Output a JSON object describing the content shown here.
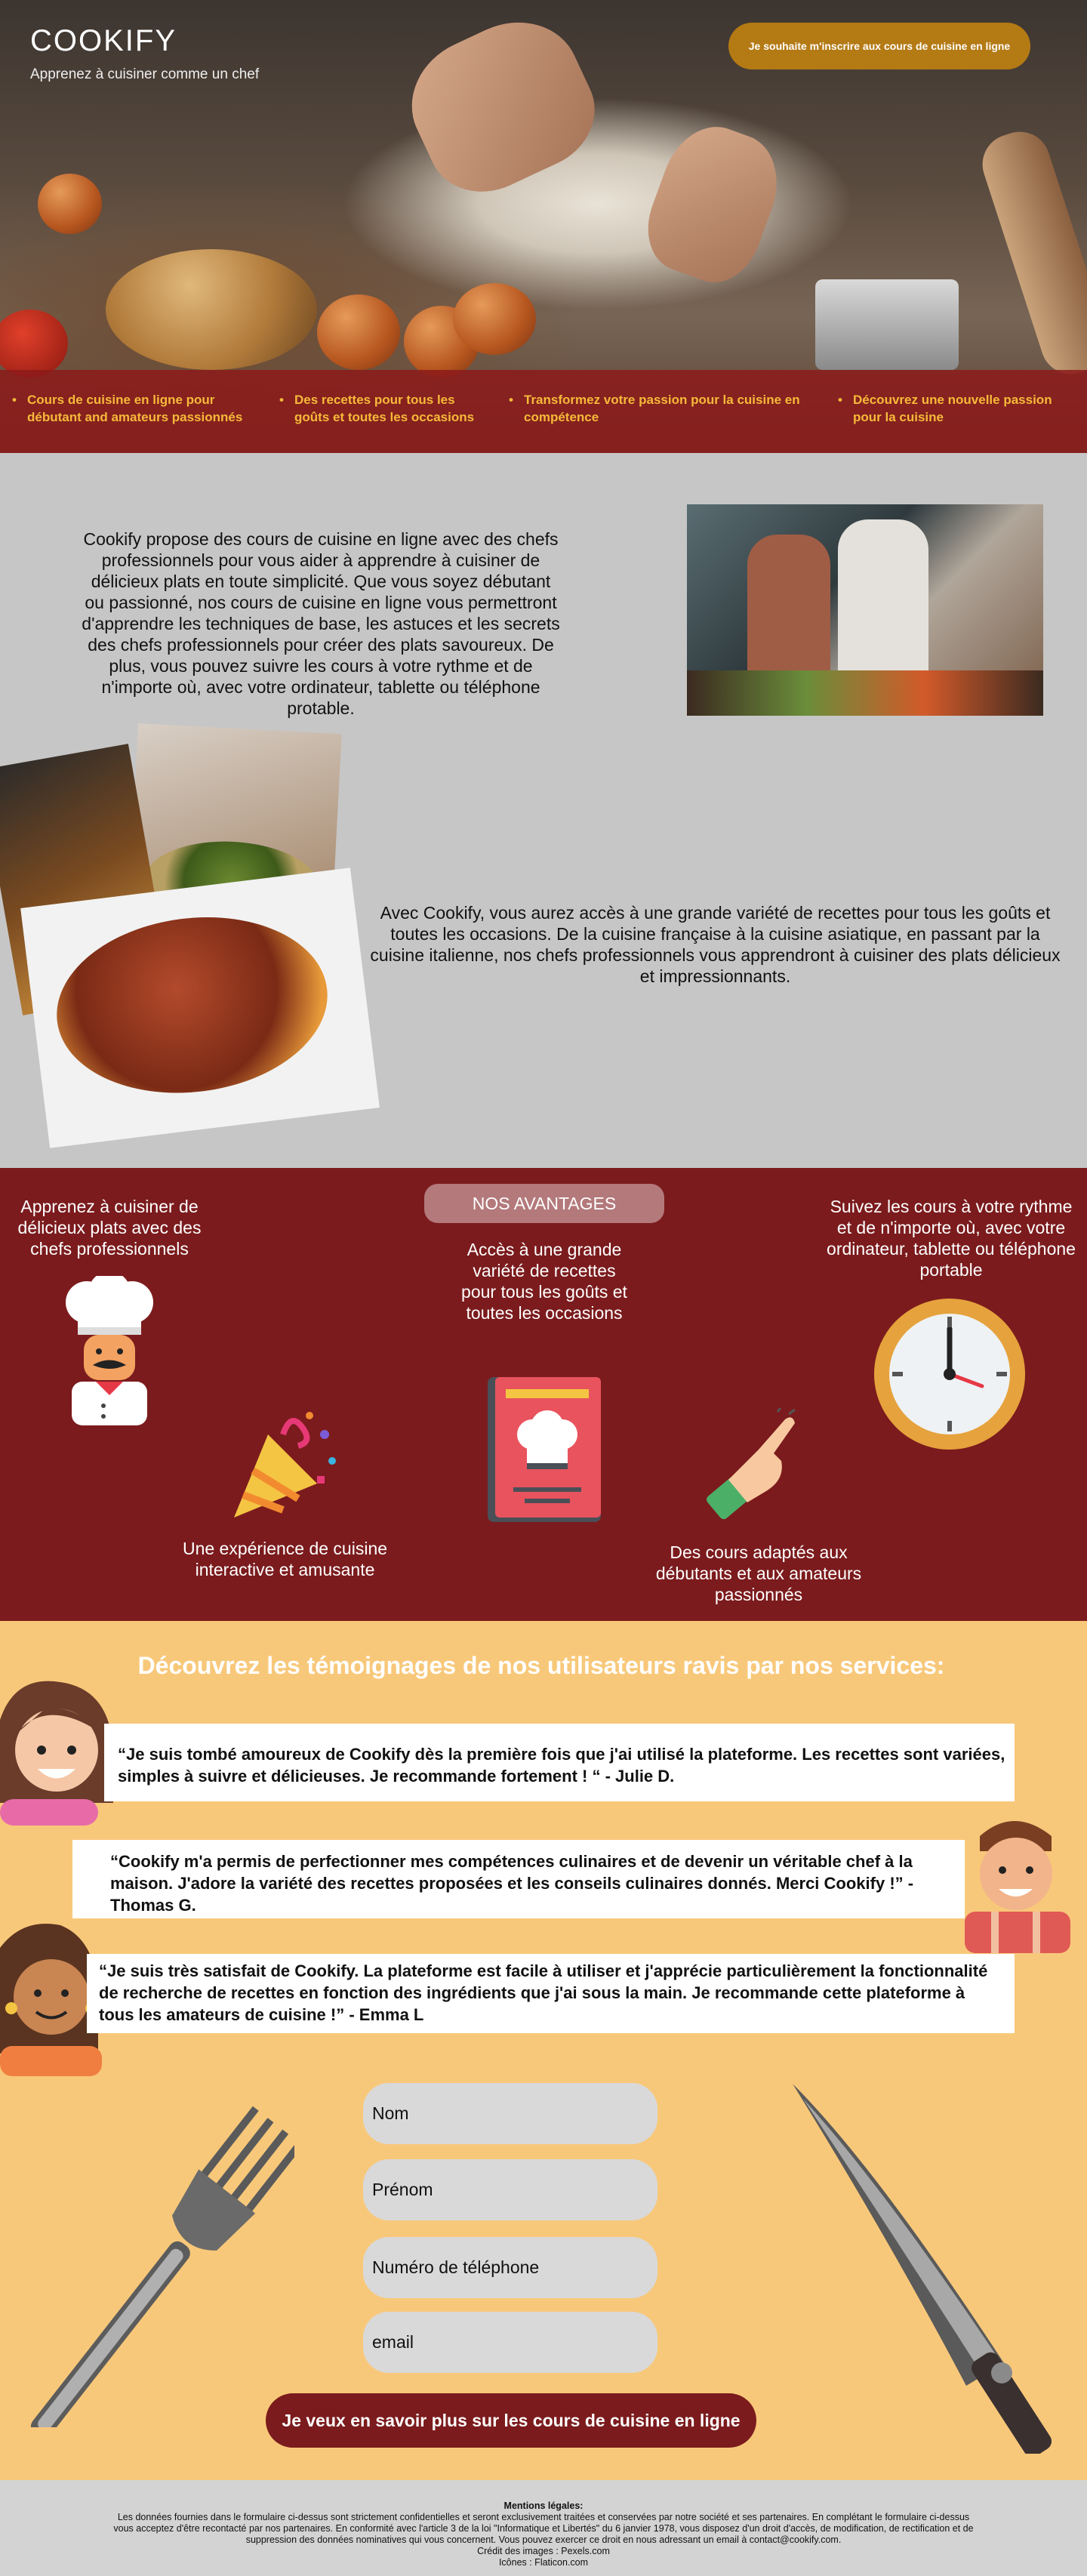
{
  "header": {
    "brand": "COOKIFY",
    "tagline": "Apprenez à cuisiner comme un chef",
    "cta": "Je souhaite m'inscrire aux cours de cuisine en ligne"
  },
  "features": [
    "Cours de cuisine en ligne pour débutant and amateurs passionnés",
    "Des recettes pour tous les goûts et toutes les occasions",
    "Transformez votre passion pour la cuisine en compétence",
    "Découvrez une nouvelle passion pour la cuisine"
  ],
  "intro": {
    "p1": "Cookify propose des cours de cuisine en ligne avec des chefs professionnels pour vous aider à apprendre à cuisiner de délicieux plats en toute simplicité. Que vous soyez débutant ou passionné, nos cours de cuisine en ligne vous permettront d'apprendre les techniques de base, les astuces et les secrets des chefs professionnels pour créer des plats savoureux. De plus, vous pouvez suivre les cours à votre rythme et de n'importe où, avec votre ordinateur, tablette ou téléphone protable.",
    "p2": "Avec Cookify, vous aurez accès à une grande variété de recettes pour tous les goûts et toutes les occasions. De la cuisine française à la cuisine asiatique, en passant par la cuisine italienne, nos chefs professionnels vous apprendront à cuisiner des plats délicieux et impressionnants."
  },
  "advantages": {
    "title": "NOS AVANTAGES",
    "a1": "Apprenez à cuisiner de délicieux plats avec des chefs professionnels",
    "a2": "Accès à une grande variété de recettes pour tous les goûts et toutes les occasions",
    "a3": "Suivez les cours à votre rythme et de n'importe où, avec votre ordinateur, tablette ou téléphone portable",
    "a4": "Une expérience de cuisine interactive et amusante",
    "a5": "Des cours adaptés aux débutants et aux amateurs passionnés",
    "icons": [
      "chef-icon",
      "party-popper-icon",
      "recipe-book-icon",
      "pointing-hand-icon",
      "clock-icon"
    ]
  },
  "testimonials": {
    "title": "Découvrez les témoignages de nos utilisateurs ravis par nos services:",
    "items": [
      "“Je suis tombé amoureux de Cookify dès la première fois que j'ai utilisé la plateforme. Les recettes sont variées, simples à suivre et délicieuses. Je recommande fortement ! “ - Julie D.",
      "“Cookify m'a permis de perfectionner mes compétences culinaires et de devenir un véritable chef à la maison. J'adore la variété des recettes proposées et les conseils culinaires donnés. Merci Cookify !” - Thomas G.",
      "“Je suis très satisfait de Cookify. La plateforme est facile à utiliser et j'apprécie particulièrement la fonctionnalité de recherche de recettes en fonction des ingrédients que j'ai sous la main. Je recommande cette plateforme à tous les amateurs de cuisine !” - Emma L"
    ]
  },
  "form": {
    "nom": "Nom",
    "prenom": "Prénom",
    "tel": "Numéro de téléphone",
    "email": "email",
    "submit": "Je veux en savoir plus sur les cours de cuisine en ligne"
  },
  "footer": {
    "title": "Mentions légales:",
    "text": "Les données fournies dans le formulaire ci-dessus sont strictement confidentielles et seront exclusivement traitées et conservées par notre société et ses partenaires. En complétant le formulaire ci-dessus vous acceptez d'être recontacté par nos partenaires. En conformité avec l'article 3 de la loi \"Informatique et Libertés\" du 6 janvier 1978, vous disposez d'un droit d'accès, de modification, de rectification et de suppression des données nominatives qui vous concernent. Vous pouvez exercer ce droit en nous adressant un email à contact@cookify.com.",
    "credit1": "Crédit des images : Pexels.com",
    "credit2": "Icônes : Flaticon.com"
  },
  "colors": {
    "accent": "#7b1b1d",
    "gold": "#b47a14",
    "yellow": "#f7b93a",
    "peach": "#f8c87a"
  }
}
